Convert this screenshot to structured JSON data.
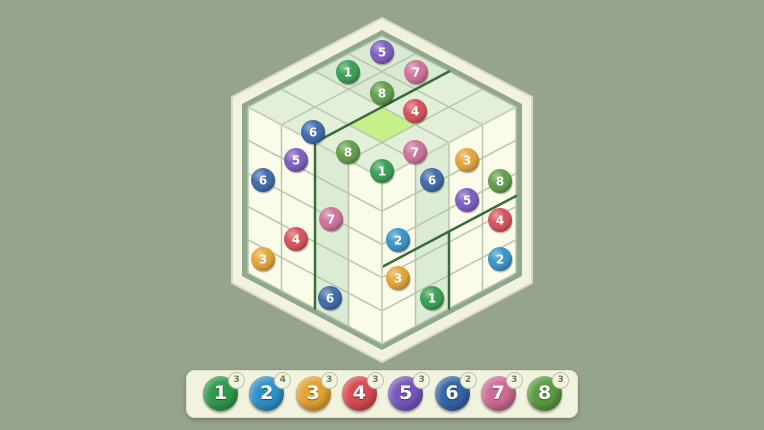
{
  "colors": {
    "background": "#96a48e",
    "frame": "#f2f3df",
    "frame_inner": "#8fa88b",
    "cell_light": "#fafbe9",
    "cell_tint": "#d9e9d2",
    "highlight": "#c6f08a",
    "grid_line": "#b7c6ad",
    "divider": "#3a6b3a",
    "digits": {
      "1": "#2f9a4c",
      "2": "#2e90c6",
      "3": "#e3a130",
      "4": "#d64a52",
      "5": "#7756bd",
      "6": "#3464a6",
      "7": "#cc6b95",
      "8": "#5a9a41"
    }
  },
  "board": {
    "description_free": true,
    "placed": [
      {
        "digit": "5"
      },
      {
        "digit": "1"
      },
      {
        "digit": "7"
      },
      {
        "digit": "8"
      },
      {
        "digit": "4"
      },
      {
        "digit": "6"
      },
      {
        "digit": "8"
      },
      {
        "digit": "7"
      },
      {
        "digit": "1"
      },
      {
        "digit": "5"
      },
      {
        "digit": "3"
      },
      {
        "digit": "6"
      },
      {
        "digit": "6"
      },
      {
        "digit": "8"
      },
      {
        "digit": "5"
      },
      {
        "digit": "7"
      },
      {
        "digit": "4"
      },
      {
        "digit": "2"
      },
      {
        "digit": "4"
      },
      {
        "digit": "2"
      },
      {
        "digit": "3"
      },
      {
        "digit": "3"
      },
      {
        "digit": "6"
      },
      {
        "digit": "1"
      }
    ]
  },
  "palette": [
    {
      "digit": "1",
      "remaining": "3",
      "color": "#2f9a4c"
    },
    {
      "digit": "2",
      "remaining": "4",
      "color": "#2e90c6"
    },
    {
      "digit": "3",
      "remaining": "3",
      "color": "#e3a130"
    },
    {
      "digit": "4",
      "remaining": "3",
      "color": "#d64a52"
    },
    {
      "digit": "5",
      "remaining": "3",
      "color": "#7756bd"
    },
    {
      "digit": "6",
      "remaining": "2",
      "color": "#3464a6"
    },
    {
      "digit": "7",
      "remaining": "3",
      "color": "#cc6b95"
    },
    {
      "digit": "8",
      "remaining": "3",
      "color": "#5a9a41"
    }
  ]
}
